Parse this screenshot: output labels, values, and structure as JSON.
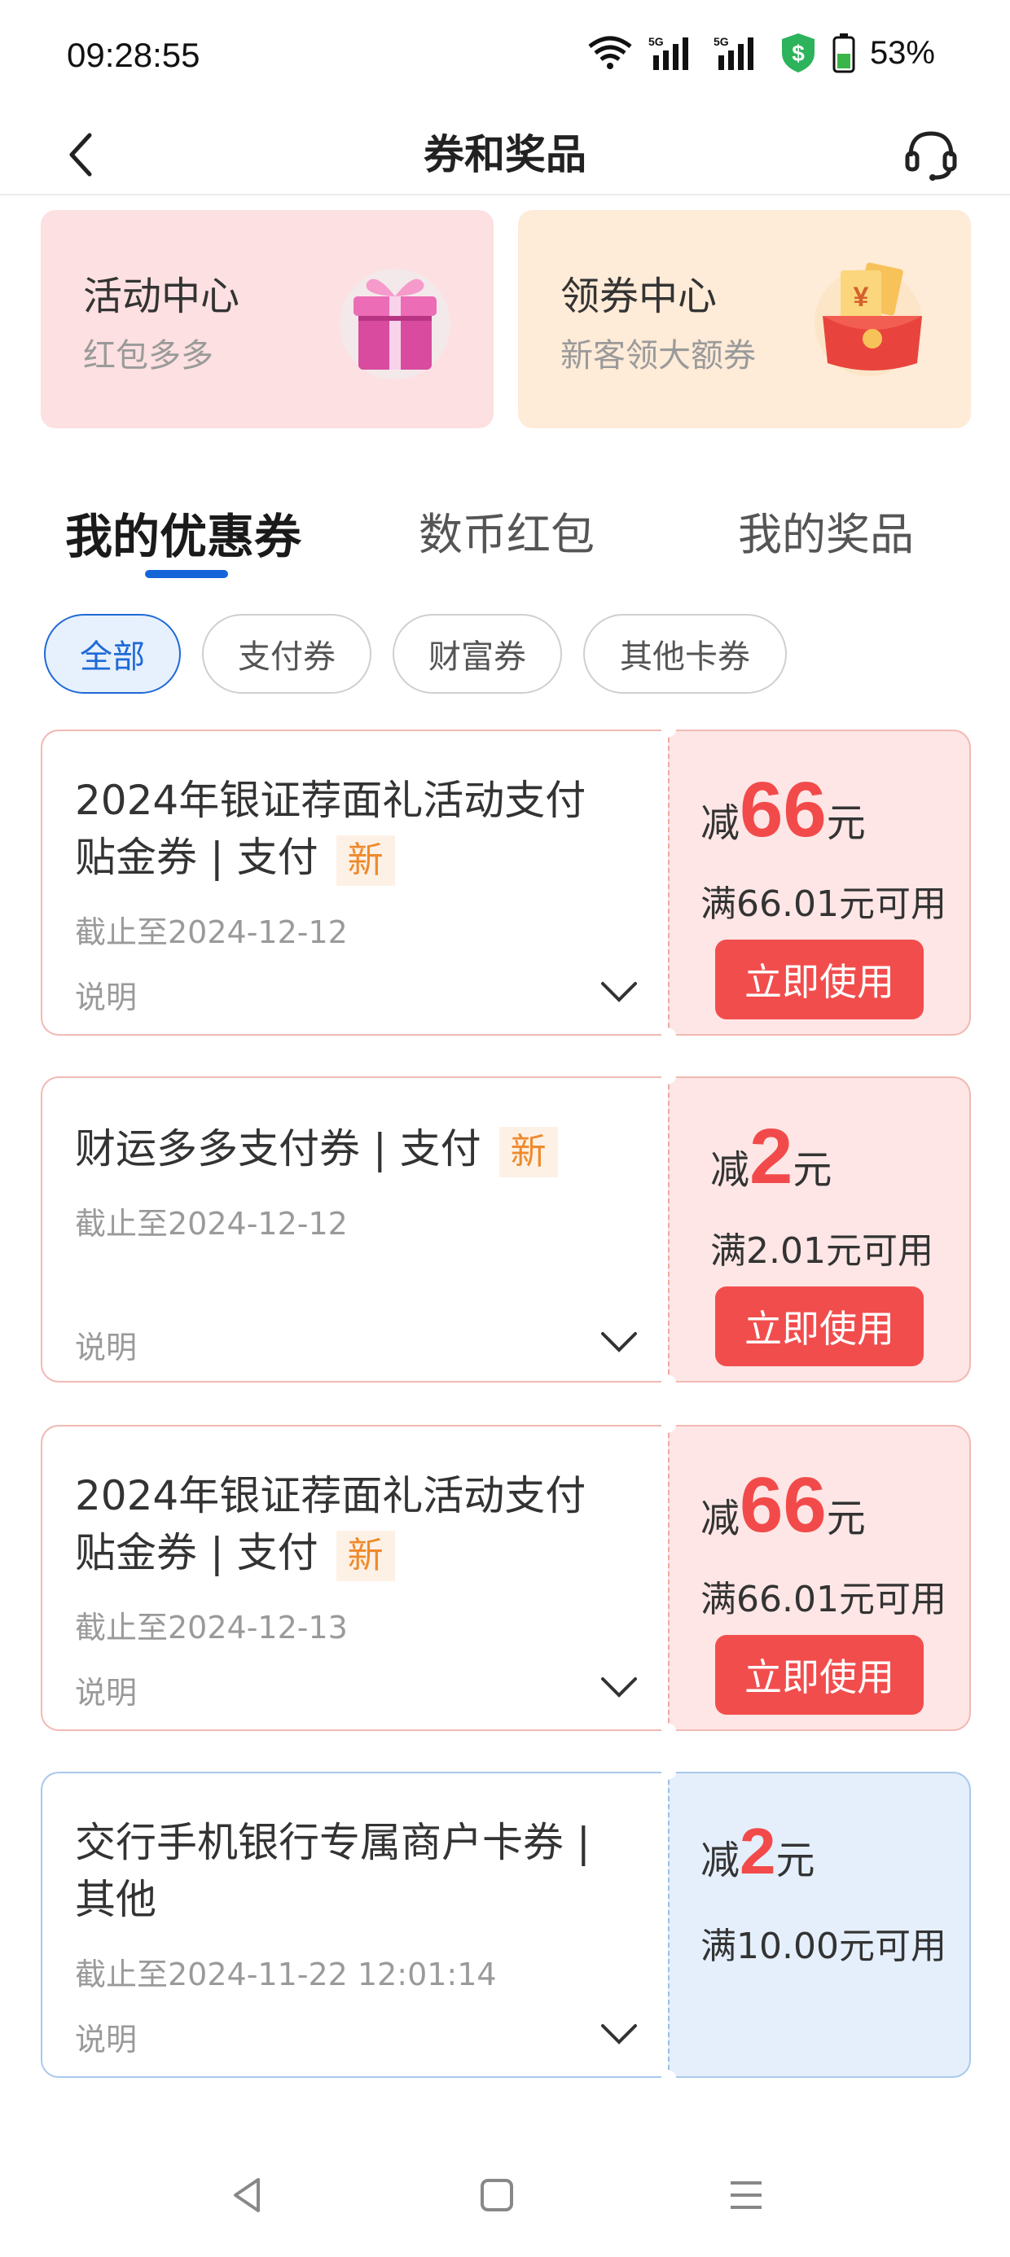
{
  "status_bar": {
    "time": "09:28:55",
    "battery_percent": "53%",
    "icons": [
      "wifi-icon",
      "signal-5g-icon",
      "signal-5g-icon",
      "security-shield-icon",
      "battery-icon"
    ],
    "shield_color": "#2cb35b"
  },
  "nav": {
    "title": "券和奖品",
    "back_icon": "chevron-left-icon",
    "service_icon": "headset-icon"
  },
  "promos": [
    {
      "title": "活动中心",
      "subtitle": "红包多多",
      "icon": "gift-box-icon",
      "bg": "#fde0e1"
    },
    {
      "title": "领券中心",
      "subtitle": "新客领大额券",
      "icon": "red-envelope-icon",
      "bg": "#feebd8"
    }
  ],
  "tabs": [
    {
      "label": "我的优惠券",
      "active": true
    },
    {
      "label": "数币红包",
      "active": false
    },
    {
      "label": "我的奖品",
      "active": false
    }
  ],
  "filters": [
    {
      "label": "全部",
      "active": true
    },
    {
      "label": "支付券",
      "active": false
    },
    {
      "label": "财富券",
      "active": false
    },
    {
      "label": "其他卡券",
      "active": false
    }
  ],
  "coupons": [
    {
      "title": "2024年银证荐面礼活动支付贴金券 | 支付",
      "title_line1": "2024年银证荐面礼活动支付",
      "title_line2": "贴金券 | 支付",
      "badge": "新",
      "expiry": "截止至2024-12-12",
      "desc_label": "说明",
      "amount_prefix": "减",
      "amount": "66",
      "amount_suffix": "元",
      "condition": "满66.01元可用",
      "button": "立即使用",
      "theme": "red"
    },
    {
      "title": "财运多多支付券 | 支付",
      "title_line1": "财运多多支付券 | 支付",
      "badge": "新",
      "expiry": "截止至2024-12-12",
      "desc_label": "说明",
      "amount_prefix": "减",
      "amount": "2",
      "amount_suffix": "元",
      "condition": "满2.01元可用",
      "button": "立即使用",
      "theme": "red"
    },
    {
      "title": "2024年银证荐面礼活动支付贴金券 | 支付",
      "title_line1": "2024年银证荐面礼活动支付",
      "title_line2": "贴金券 | 支付",
      "badge": "新",
      "expiry": "截止至2024-12-13",
      "desc_label": "说明",
      "amount_prefix": "减",
      "amount": "66",
      "amount_suffix": "元",
      "condition": "满66.01元可用",
      "button": "立即使用",
      "theme": "red"
    },
    {
      "title": "交行手机银行专属商户卡券 | 其他",
      "title_line1": "交行手机银行专属商户卡券 |",
      "title_line2": "其他",
      "expiry": "截止至2024-11-22 12:01:14",
      "desc_label": "说明",
      "amount_prefix": "减",
      "amount": "2",
      "amount_suffix": "元",
      "condition": "满10.00元可用",
      "theme": "blue"
    }
  ],
  "colors": {
    "accent_blue": "#1565d8",
    "coupon_red": "#f24a4a",
    "badge_orange": "#ee8a2c"
  },
  "system_nav": [
    "back-triangle-icon",
    "home-square-icon",
    "menu-lines-icon"
  ]
}
